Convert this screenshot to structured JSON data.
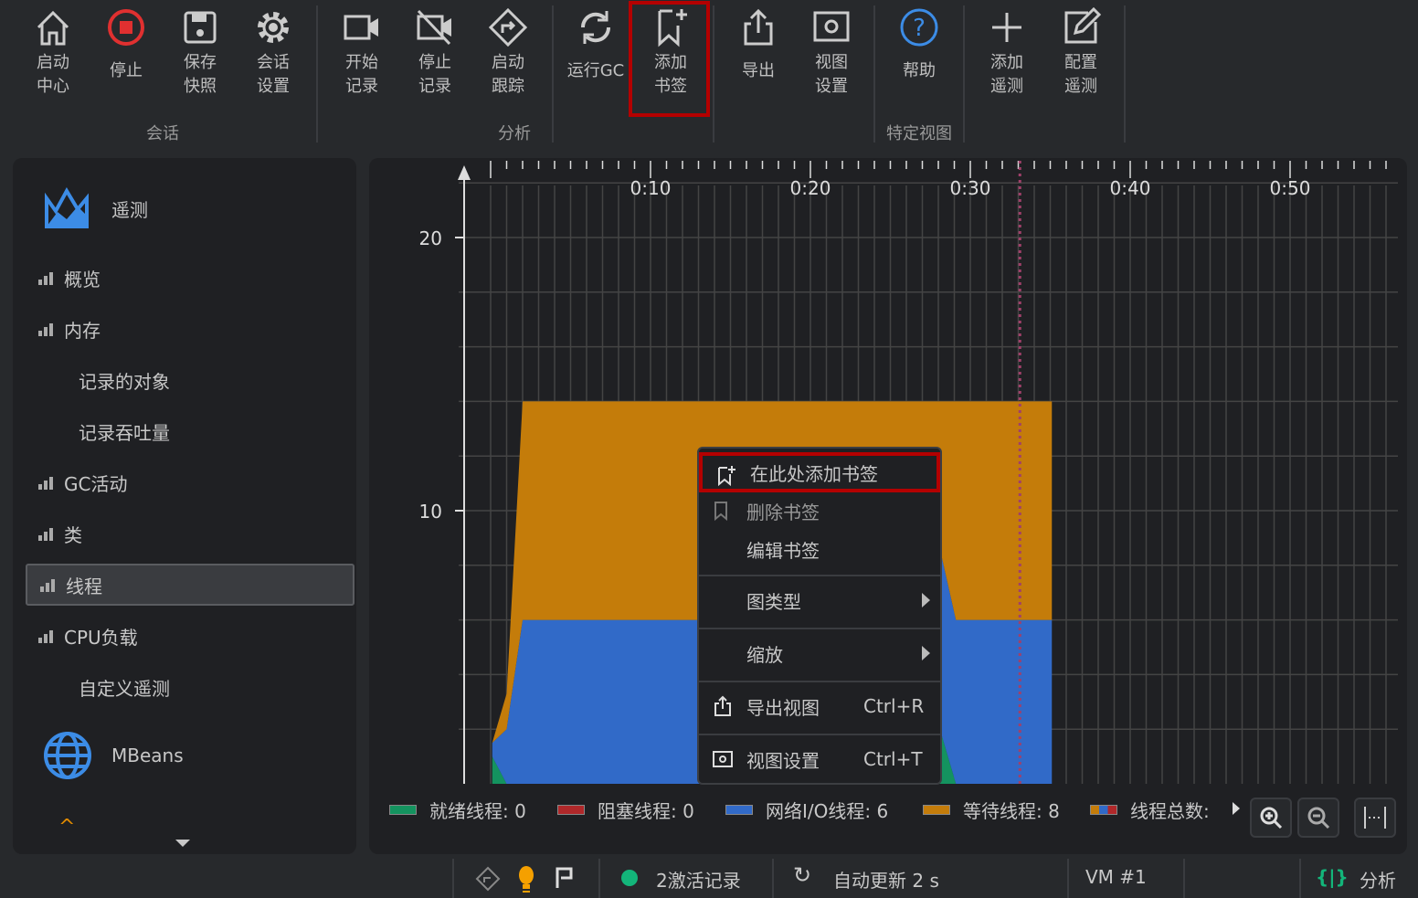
{
  "toolbar": {
    "buttons": [
      {
        "id": "start-center",
        "label": "启动\n中心",
        "l1": "启动",
        "l2": "中心"
      },
      {
        "id": "stop",
        "label": "停止"
      },
      {
        "id": "save-snapshot",
        "l1": "保存",
        "l2": "快照"
      },
      {
        "id": "session-settings",
        "l1": "会话",
        "l2": "设置"
      },
      {
        "id": "start-recording",
        "l1": "开始",
        "l2": "记录"
      },
      {
        "id": "stop-recording",
        "l1": "停止",
        "l2": "记录"
      },
      {
        "id": "start-tracking",
        "l1": "启动",
        "l2": "跟踪"
      },
      {
        "id": "run-gc",
        "label": "运行GC"
      },
      {
        "id": "add-bookmark",
        "l1": "添加",
        "l2": "书签"
      },
      {
        "id": "export",
        "label": "导出"
      },
      {
        "id": "view-settings",
        "l1": "视图",
        "l2": "设置"
      },
      {
        "id": "help",
        "label": "帮助"
      },
      {
        "id": "add-telemetry",
        "l1": "添加",
        "l2": "遥测"
      },
      {
        "id": "configure-telemetry",
        "l1": "配置",
        "l2": "遥测"
      }
    ],
    "groups": [
      "会话",
      "分析",
      "特定视图"
    ]
  },
  "sidebar": {
    "section_telemetry": "遥测",
    "items": [
      {
        "label": "概览",
        "bars": true
      },
      {
        "label": "内存",
        "bars": true
      },
      {
        "label": "记录的对象",
        "bars": false
      },
      {
        "label": "记录吞吐量",
        "bars": false
      },
      {
        "label": "GC活动",
        "bars": true
      },
      {
        "label": "类",
        "bars": true
      },
      {
        "label": "线程",
        "bars": true,
        "selected": true
      },
      {
        "label": "CPU负载",
        "bars": true
      },
      {
        "label": "自定义遥测",
        "bars": false
      }
    ],
    "section_mbeans": "MBeans"
  },
  "context_menu": {
    "items": [
      {
        "label": "在此处添加书签",
        "icon": "bookmark-add-icon"
      },
      {
        "label": "删除书签",
        "icon": "bookmark-remove-icon"
      },
      {
        "label": "编辑书签"
      },
      {
        "label": "图类型",
        "submenu": true
      },
      {
        "label": "缩放",
        "submenu": true
      },
      {
        "label": "导出视图",
        "shortcut": "Ctrl+R",
        "icon": "export-icon"
      },
      {
        "label": "视图设置",
        "shortcut": "Ctrl+T",
        "icon": "view-settings-icon"
      }
    ]
  },
  "legend": [
    {
      "label": "就绪线程: 0",
      "color": "#14935f"
    },
    {
      "label": "阻塞线程: 0",
      "color": "#b0282a"
    },
    {
      "label": "网络I/O线程: 6",
      "color": "#316ac8"
    },
    {
      "label": "等待线程: 8",
      "color": "#c47c0a"
    },
    {
      "label": "线程总数:",
      "color": "multi"
    }
  ],
  "status": {
    "recordings": "2激活记录",
    "auto_update": "自动更新 2 s",
    "vm": "VM #1",
    "analysis": "分析"
  },
  "chart_data": {
    "type": "area",
    "stacked": true,
    "xlabel": "",
    "ylabel": "",
    "x_ticks": [
      "0:10",
      "0:20",
      "0:30",
      "0:40",
      "0:50"
    ],
    "x_tick_values": [
      10,
      20,
      30,
      40,
      50
    ],
    "y_ticks": [
      "10",
      "20"
    ],
    "y_tick_values": [
      10,
      20
    ],
    "xlim": [
      0,
      56.6
    ],
    "ylim": [
      0,
      22.2
    ],
    "grid": true,
    "bookmark_time": 33.1,
    "x": [
      0.1,
      1,
      2,
      28,
      28.1,
      29.1,
      35.1
    ],
    "series": [
      {
        "name": "就绪线程",
        "color": "#14935f",
        "values": [
          1,
          0,
          0,
          0,
          2,
          0,
          0
        ]
      },
      {
        "name": "阻塞线程",
        "color": "#b0282a",
        "values": [
          0,
          0,
          0,
          0,
          0,
          0,
          0
        ]
      },
      {
        "name": "网络I/O线程",
        "color": "#316ac8",
        "values": [
          0.5,
          2,
          6,
          6,
          6.6,
          6,
          6
        ]
      },
      {
        "name": "等待线程",
        "color": "#c47c0a",
        "values": [
          0,
          1.3,
          8,
          8,
          5.4,
          8,
          8
        ]
      }
    ]
  }
}
